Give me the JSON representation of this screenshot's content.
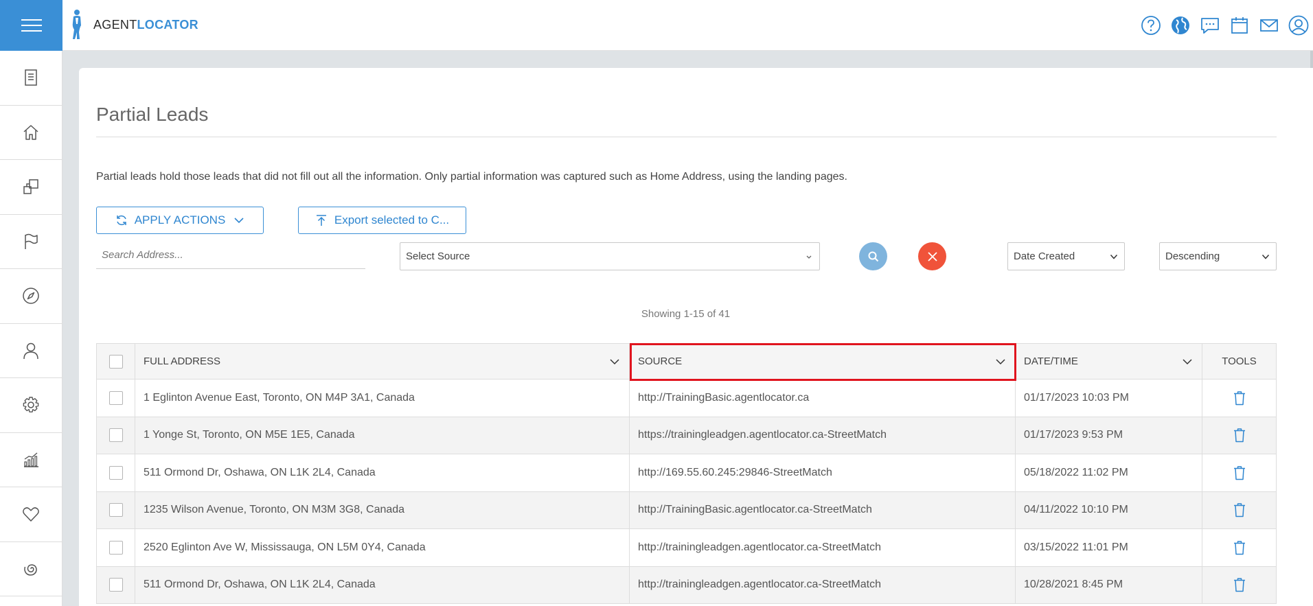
{
  "app": {
    "brand_part1": "AGENT",
    "brand_part2": "LOCATOR",
    "accent_color": "#3a8fd6"
  },
  "topbar": {
    "icons": [
      "help-icon",
      "globe-icon",
      "chat-icon",
      "calendar-icon",
      "mail-icon",
      "user-icon"
    ]
  },
  "sidebar": {
    "items": [
      "document-icon",
      "home-icon",
      "copy-icon",
      "flag-icon",
      "compass-icon",
      "person-icon",
      "gear-icon",
      "chart-icon",
      "heart-icon",
      "spiral-icon"
    ]
  },
  "page": {
    "title": "Partial Leads",
    "description": "Partial leads hold those leads that did not fill out all the information. Only partial information was captured such as Home Address, using the landing pages."
  },
  "toolbar": {
    "apply_actions_label": "APPLY ACTIONS",
    "export_label": "Export selected to C...",
    "search_placeholder": "Search Address...",
    "source_select": "Select Source",
    "sort_field": "Date Created",
    "sort_order": "Descending"
  },
  "pagination": {
    "showing": "Showing 1-15 of 41"
  },
  "table": {
    "headers": {
      "address": "FULL ADDRESS",
      "source": "SOURCE",
      "datetime": "DATE/TIME",
      "tools": "TOOLS"
    },
    "rows": [
      {
        "address": "1 Eglinton Avenue East, Toronto, ON M4P 3A1, Canada",
        "source": "http://TrainingBasic.agentlocator.ca",
        "datetime": "01/17/2023 10:03 PM"
      },
      {
        "address": "1 Yonge St, Toronto, ON M5E 1E5, Canada",
        "source": "https://trainingleadgen.agentlocator.ca-StreetMatch",
        "datetime": "01/17/2023 9:53 PM"
      },
      {
        "address": "511 Ormond Dr, Oshawa, ON L1K 2L4, Canada",
        "source": "http://169.55.60.245:29846-StreetMatch",
        "datetime": "05/18/2022 11:02 PM"
      },
      {
        "address": "1235 Wilson Avenue, Toronto, ON M3M 3G8, Canada",
        "source": "http://TrainingBasic.agentlocator.ca-StreetMatch",
        "datetime": "04/11/2022 10:10 PM"
      },
      {
        "address": "2520 Eglinton Ave W, Mississauga, ON L5M 0Y4, Canada",
        "source": "http://trainingleadgen.agentlocator.ca-StreetMatch",
        "datetime": "03/15/2022 11:01 PM"
      },
      {
        "address": "511 Ormond Dr, Oshawa, ON L1K 2L4, Canada",
        "source": "http://trainingleadgen.agentlocator.ca-StreetMatch",
        "datetime": "10/28/2021 8:45 PM"
      }
    ]
  }
}
